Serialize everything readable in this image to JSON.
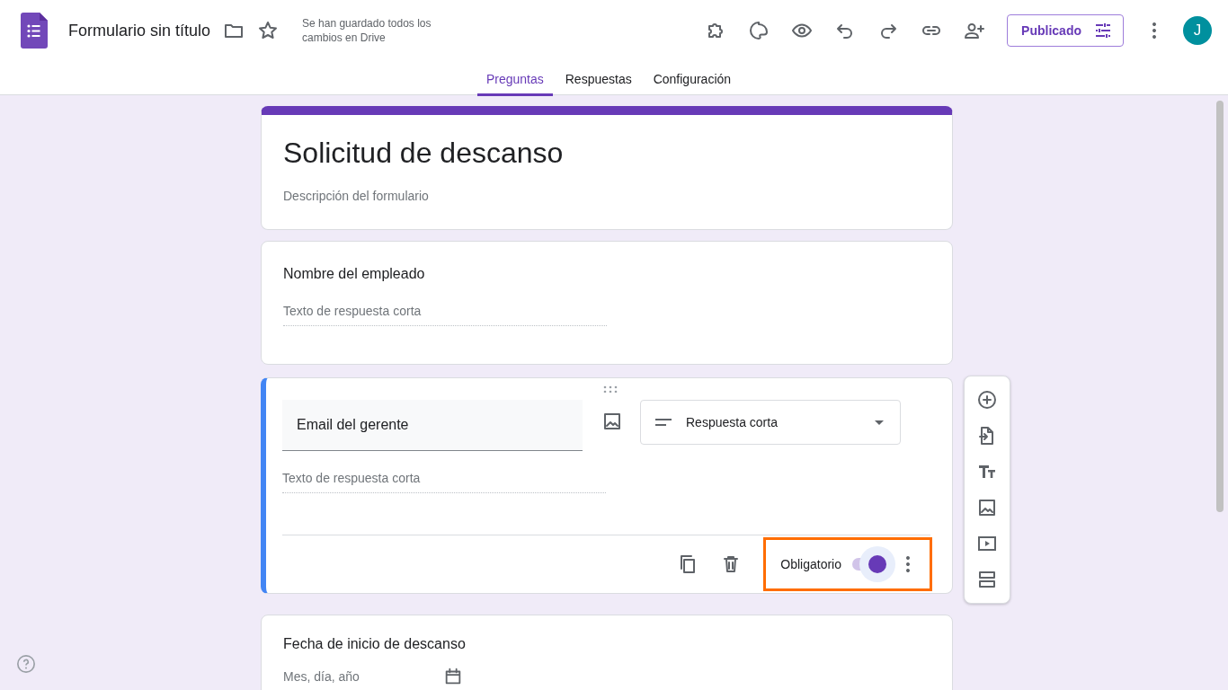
{
  "app": {
    "title": "Formulario sin título",
    "save_status": "Se han guardado todos los cambios en Drive",
    "publish_button": "Publicado",
    "avatar": "J"
  },
  "tabs": [
    {
      "label": "Preguntas",
      "selected": true
    },
    {
      "label": "Respuestas",
      "selected": false
    },
    {
      "label": "Configuración",
      "selected": false
    }
  ],
  "form": {
    "title": "Solicitud de descanso",
    "description_placeholder": "Descripción del formulario"
  },
  "questions": [
    {
      "kind": "short",
      "title": "Nombre del empleado",
      "answer_placeholder": "Texto de respuesta corta",
      "active": false
    },
    {
      "kind": "short",
      "title": "Email del gerente",
      "answer_placeholder": "Texto de respuesta corta",
      "active": true,
      "type_label": "Respuesta corta",
      "required_label": "Obligatorio",
      "required": true,
      "highlighted": true
    },
    {
      "kind": "date",
      "title": "Fecha de inicio de descanso",
      "answer_placeholder": "Mes, día, año",
      "active": false
    }
  ]
}
